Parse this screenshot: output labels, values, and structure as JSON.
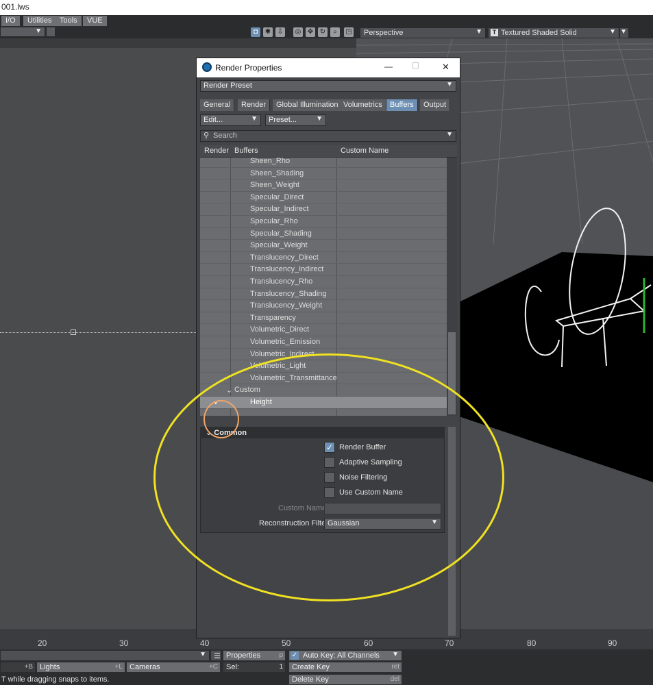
{
  "window": {
    "title": "001.lws"
  },
  "menu": {
    "tabs": [
      "I/O",
      "Utilities",
      "Tools",
      "VUE"
    ]
  },
  "viewport": {
    "view_mode": "Perspective",
    "render_mode": "Textured Shaded Solid",
    "render_mode_icon_text": "T"
  },
  "dialog": {
    "title": "Render Properties",
    "minimize": "—",
    "maximize": "☐",
    "close": "✕",
    "preset": "Render Preset",
    "tabs": [
      "General",
      "Render",
      "Global Illumination",
      "Volumetrics",
      "Buffers",
      "Output"
    ],
    "active_tab": "Buffers",
    "edit_label": "Edit...",
    "preset_label": "Preset...",
    "search_placeholder": "Search",
    "columns": [
      "Render",
      "Buffers",
      "Custom Name"
    ],
    "buffers": [
      "Sheen_Rho",
      "Sheen_Shading",
      "Sheen_Weight",
      "Specular_Direct",
      "Specular_Indirect",
      "Specular_Rho",
      "Specular_Shading",
      "Specular_Weight",
      "Translucency_Direct",
      "Translucency_Indirect",
      "Translucency_Rho",
      "Translucency_Shading",
      "Translucency_Weight",
      "Transparency",
      "Volumetric_Direct",
      "Volumetric_Emission",
      "Volumetric_Indirect",
      "Volumetric_Light",
      "Volumetric_Transmittance"
    ],
    "group_label": "Custom",
    "selected_buffer": "Height",
    "selected_check": "✓",
    "common": {
      "header": "Common",
      "render_buffer": "Render Buffer",
      "adaptive_sampling": "Adaptive Sampling",
      "noise_filtering": "Noise Filtering",
      "use_custom_name": "Use Custom Name",
      "custom_name_label": "Custom Name",
      "custom_name_value": "",
      "reconstruction_filter_label": "Reconstruction Filter",
      "reconstruction_filter_value": "Gaussian",
      "render_buffer_check": "✓"
    }
  },
  "timeline": {
    "ticks": [
      "20",
      "30",
      "40",
      "50",
      "60",
      "70",
      "80",
      "90"
    ]
  },
  "bottom": {
    "properties": "Properties",
    "properties_key": "p",
    "shift_b": "+B",
    "lights": "Lights",
    "shift_l": "+L",
    "cameras": "Cameras",
    "shift_c": "+C",
    "sel_label": "Sel:",
    "sel_value": "1",
    "auto_key": "Auto Key: All Channels",
    "auto_key_check": "✓",
    "create_key": "Create Key",
    "create_key_hint": "ret",
    "delete_key": "Delete Key",
    "delete_key_hint": "del",
    "status": "T while dragging snaps to items."
  },
  "colors": {
    "accent": "#6d8fb3",
    "highlight_yellow": "#f0e222",
    "highlight_orange": "#f0a56a"
  }
}
